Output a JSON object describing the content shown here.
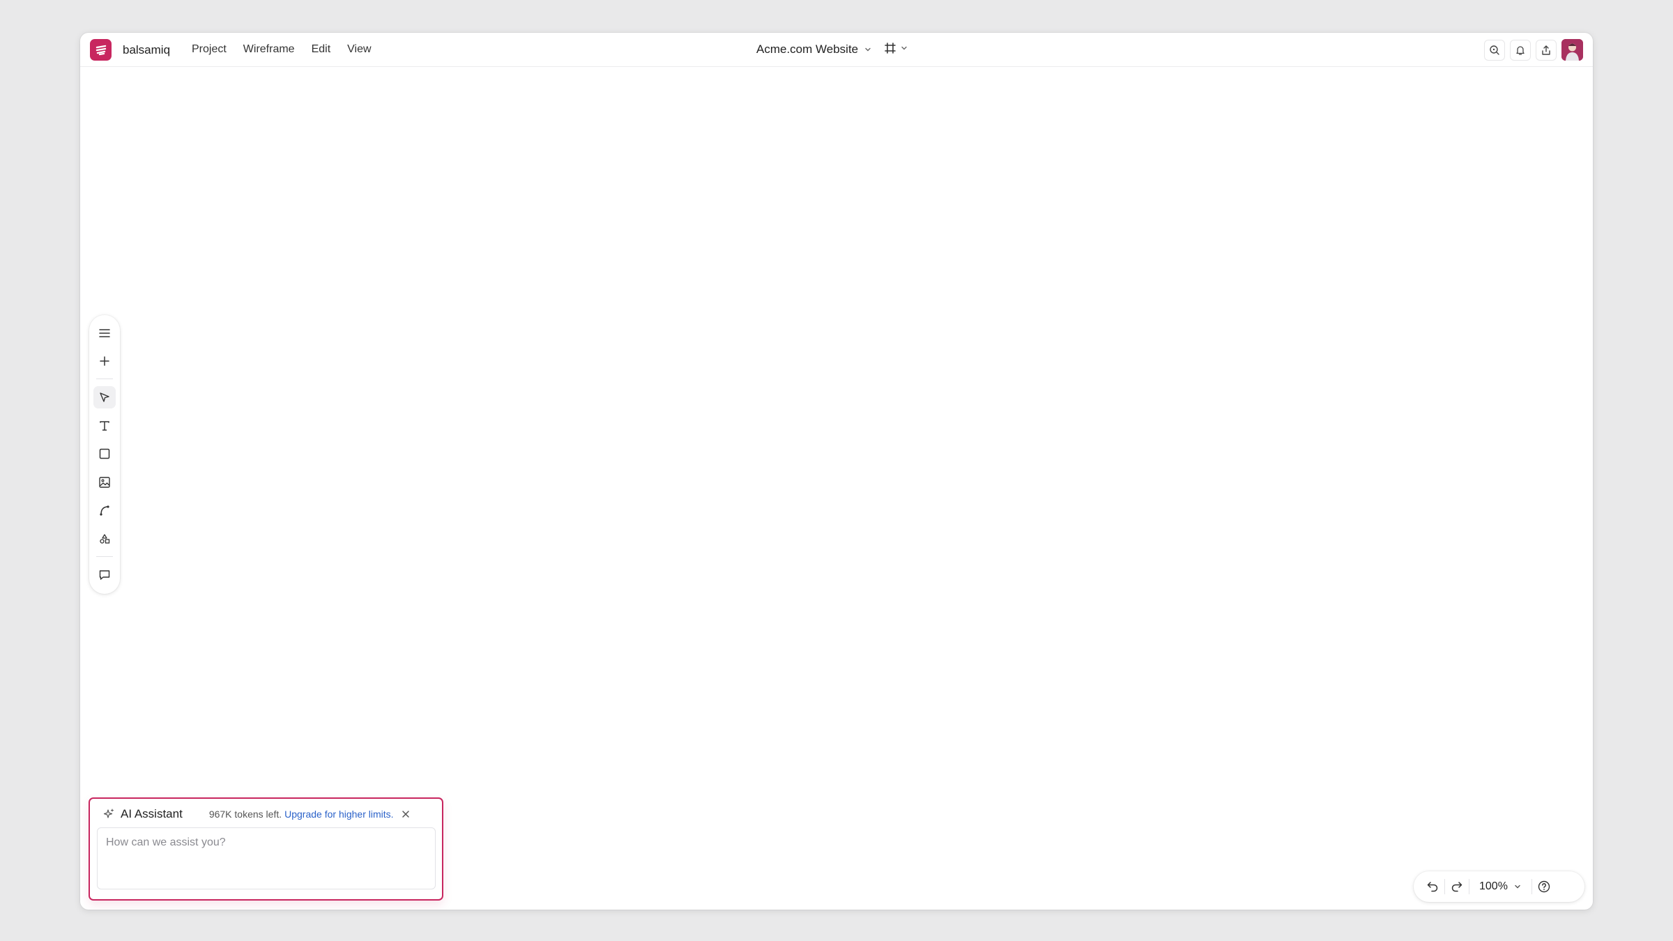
{
  "app": {
    "name": "balsamiq",
    "brand_color": "#c8265f"
  },
  "menu": [
    {
      "label": "Project"
    },
    {
      "label": "Wireframe"
    },
    {
      "label": "Edit"
    },
    {
      "label": "View"
    }
  ],
  "document": {
    "title": "Acme.com Website"
  },
  "toolbar": {
    "tools": [
      {
        "icon": "menu-icon"
      },
      {
        "icon": "plus-icon"
      },
      {
        "icon": "pointer-icon",
        "active": true
      },
      {
        "icon": "text-icon"
      },
      {
        "icon": "rectangle-icon"
      },
      {
        "icon": "image-icon"
      },
      {
        "icon": "connector-icon"
      },
      {
        "icon": "shapes-icon"
      },
      {
        "icon": "comment-icon"
      }
    ]
  },
  "ai_assistant": {
    "title": "AI Assistant",
    "tokens_text": "967K tokens left.",
    "upgrade_text": "Upgrade for higher limits.",
    "input_placeholder": "How can we assist you?",
    "input_value": ""
  },
  "zoom": {
    "level": "100%"
  },
  "top_right_icons": [
    "search-icon",
    "bell-icon",
    "share-icon",
    "avatar"
  ]
}
